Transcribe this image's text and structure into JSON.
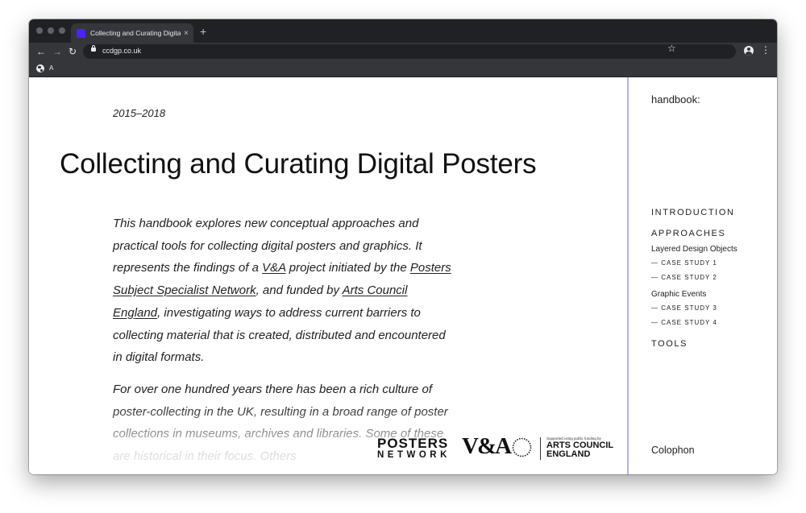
{
  "browser": {
    "tab_title": "Collecting and Curating Digital P",
    "tab_close": "×",
    "new_tab": "+",
    "url": "ccdgp.co.uk",
    "bookmark_label": "A",
    "icons": [
      "back-arrow-icon",
      "forward-arrow-icon",
      "reload-icon",
      "lock-icon",
      "star-icon",
      "profile-icon",
      "menu-dots-icon",
      "globe-icon"
    ]
  },
  "page": {
    "dates": "2015–2018",
    "title": "Collecting and Curating Digital Posters",
    "p1": {
      "t1": "This handbook explores new conceptual approaches and practical tools for collecting digital posters and graphics. It represents the findings of a ",
      "link1": "V&A",
      "t2": " project initiated by the ",
      "link2": "Posters Subject Specialist Network",
      "t3": ", and funded by ",
      "link3": "Arts Council England",
      "t4": ", investigating ways to address current barriers to collecting material that is created, distributed and encountered in digital formats."
    },
    "p2": "For over one hundred years there has been a rich culture of poster-collecting in the UK, resulting in a broad range of poster collections in museums, archives and libraries. Some of these are historical in their focus. Others",
    "logos": {
      "posters_line1": "POSTERS",
      "posters_line2": "NETWORK",
      "va": "V&A",
      "ace_small": "Supported using public funding by",
      "ace_line1": "ARTS COUNCIL",
      "ace_line2": "ENGLAND"
    }
  },
  "sidebar": {
    "title": "handbook:",
    "introduction": "INTRODUCTION",
    "approaches": "APPROACHES",
    "layered": "Layered Design Objects",
    "case1": "— CASE STUDY 1",
    "case2": "— CASE STUDY 2",
    "graphic_events": "Graphic Events",
    "case3": "— CASE STUDY 3",
    "case4": "— CASE STUDY 4",
    "tools": "TOOLS",
    "colophon": "Colophon"
  },
  "colors": {
    "favicon": "#4b21ff",
    "sidebar_border": "#b3aef5",
    "chrome_dark": "#202124",
    "chrome_toolbar": "#35363a"
  }
}
